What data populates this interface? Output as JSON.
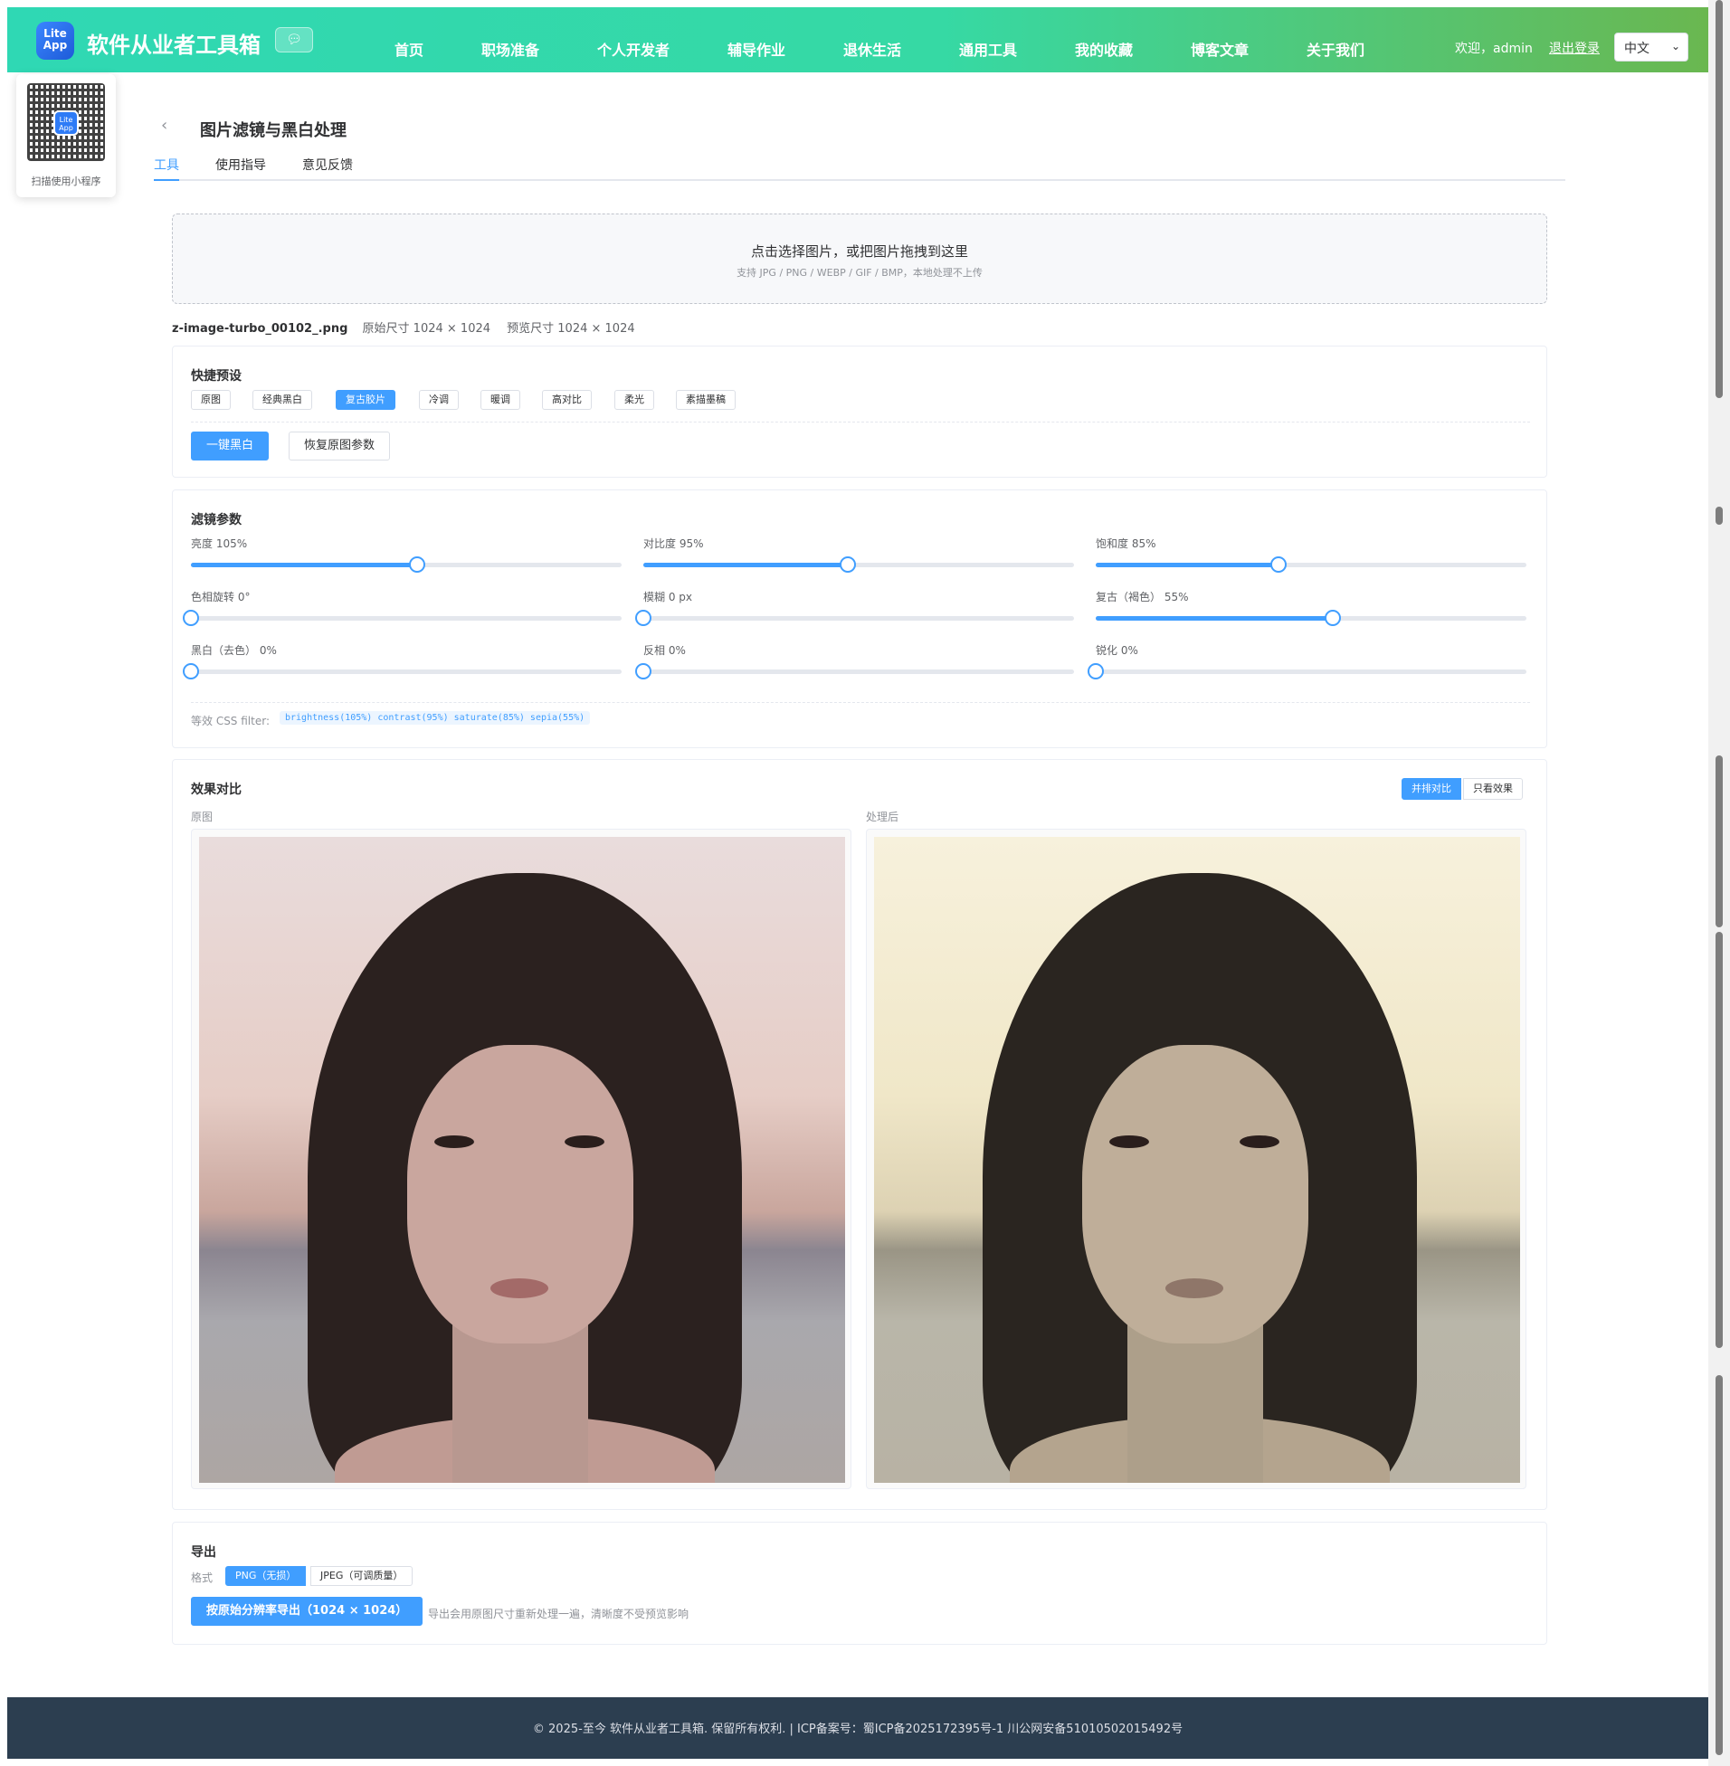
{
  "header": {
    "logo_text": "Lite App",
    "site_title": "软件从业者工具箱",
    "nav": [
      "首页",
      "职场准备",
      "个人开发者",
      "辅导作业",
      "退休生活",
      "通用工具",
      "我的收藏",
      "博客文章",
      "关于我们"
    ],
    "welcome": "欢迎，admin",
    "logout": "退出登录",
    "language": "中文"
  },
  "qr": {
    "center_text": "Lite App",
    "label": "扫描使用小程序"
  },
  "page": {
    "title": "图片滤镜与黑白处理",
    "tabs": [
      "工具",
      "使用指导",
      "意见反馈"
    ]
  },
  "upload": {
    "title": "点击选择图片，或把图片拖拽到这里",
    "hint": "支持 JPG / PNG / WEBP / GIF / BMP，本地处理不上传"
  },
  "file": {
    "name": "z-image-turbo_00102_.png",
    "original_size": "原始尺寸 1024 × 1024",
    "preview_size": "预览尺寸 1024 × 1024"
  },
  "presets": {
    "title": "快捷预设",
    "items": [
      "原图",
      "经典黑白",
      "复古胶片",
      "冷调",
      "暖调",
      "高对比",
      "柔光",
      "素描墨稿"
    ],
    "active_index": 2,
    "bw_button": "一键黑白",
    "reset_button": "恢复原图参数"
  },
  "filters": {
    "title": "滤镜参数",
    "sliders": [
      {
        "label": "亮度 105%",
        "fraction": 0.525
      },
      {
        "label": "对比度 95%",
        "fraction": 0.475
      },
      {
        "label": "饱和度 85%",
        "fraction": 0.425
      },
      {
        "label": "色相旋转 0°",
        "fraction": 0
      },
      {
        "label": "模糊 0 px",
        "fraction": 0
      },
      {
        "label": "复古（褐色） 55%",
        "fraction": 0.55
      },
      {
        "label": "黑白（去色） 0%",
        "fraction": 0
      },
      {
        "label": "反相 0%",
        "fraction": 0
      },
      {
        "label": "锐化 0%",
        "fraction": 0
      }
    ],
    "css_label": "等效 CSS filter:",
    "css_value": "brightness(105%) contrast(95%) saturate(85%) sepia(55%)"
  },
  "compare": {
    "title": "效果对比",
    "modes": [
      "并排对比",
      "只看效果"
    ],
    "active_mode": 0,
    "original_label": "原图",
    "processed_label": "处理后"
  },
  "export": {
    "title": "导出",
    "format_label": "格式",
    "formats": [
      "PNG（无损）",
      "JPEG（可调质量）"
    ],
    "active_format": 0,
    "export_button": "按原始分辨率导出（1024 × 1024）",
    "hint": "导出会用原图尺寸重新处理一遍，清晰度不受预览影响"
  },
  "footer": {
    "text": "© 2025-至今 软件从业者工具箱. 保留所有权利.   |   ICP备案号：蜀ICP备2025172395号-1    川公网安备51010502015492号"
  },
  "colors": {
    "accent": "#409eff",
    "footer_bg": "#2c3e50",
    "header_start": "#2fd8b4",
    "header_end": "#6ab750"
  }
}
